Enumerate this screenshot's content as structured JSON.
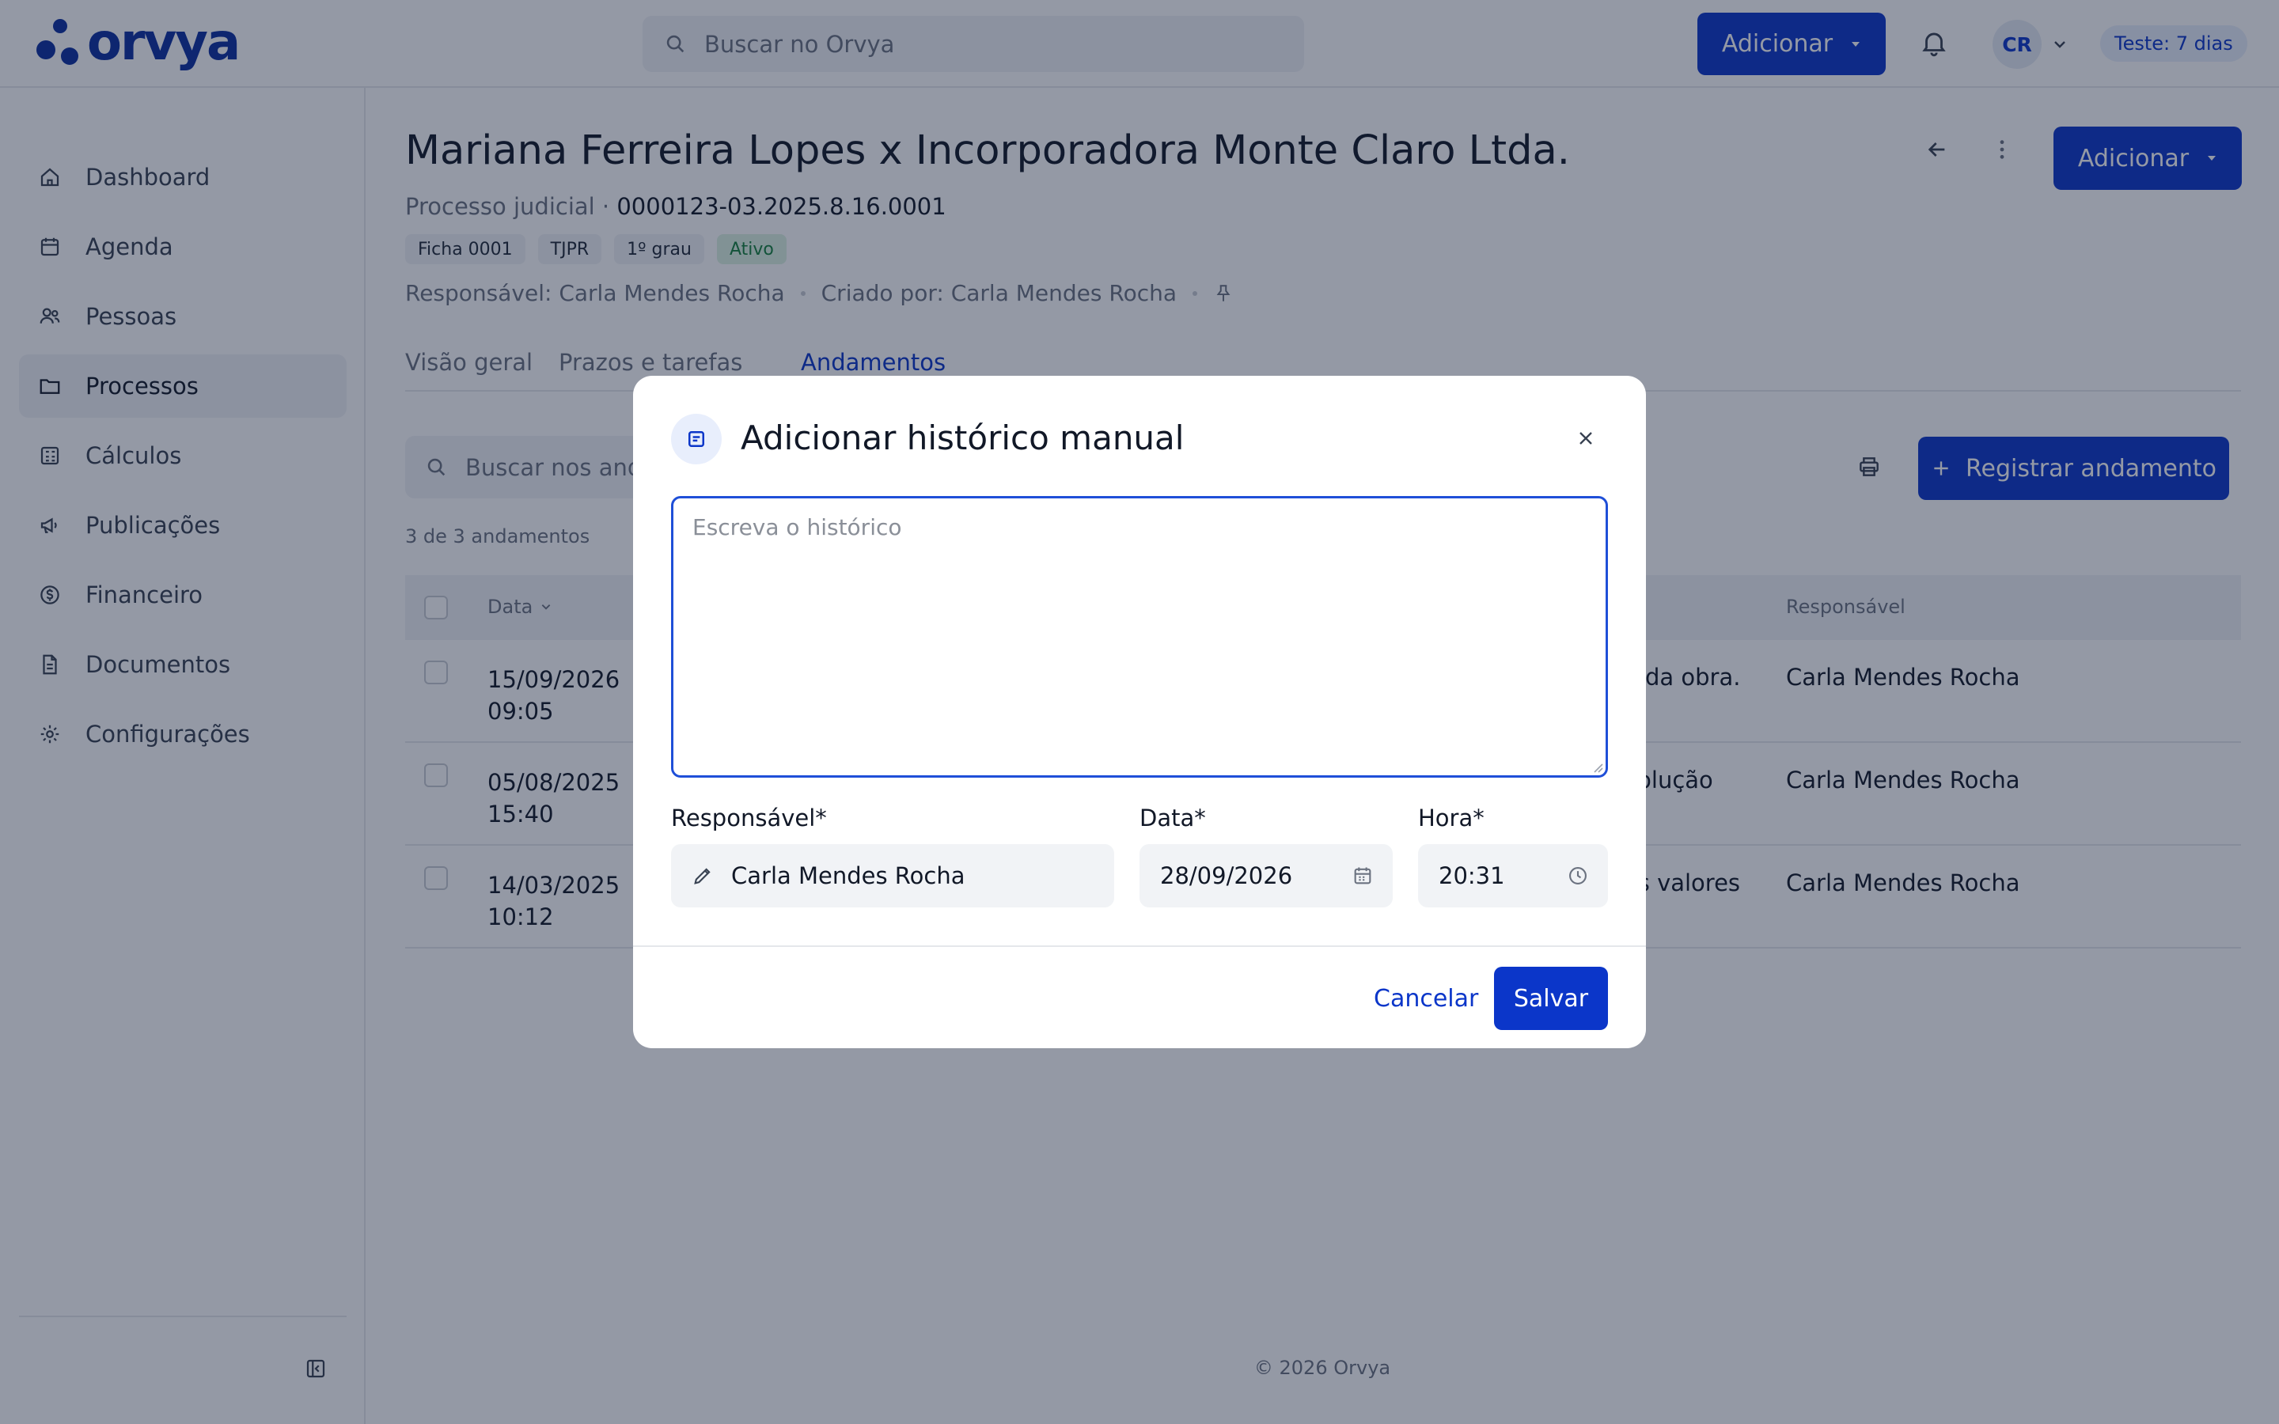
{
  "app": {
    "logo_text": "orvya",
    "brand_color": "#0b36c9"
  },
  "topbar": {
    "search_placeholder": "Buscar no Orvya",
    "add_label": "Adicionar",
    "avatar_initials": "CR",
    "trial_label": "Teste: 7 dias"
  },
  "sidebar": {
    "items": [
      {
        "label": "Dashboard",
        "icon": "home-icon"
      },
      {
        "label": "Agenda",
        "icon": "calendar-icon"
      },
      {
        "label": "Pessoas",
        "icon": "people-icon"
      },
      {
        "label": "Processos",
        "icon": "folder-icon",
        "active": true
      },
      {
        "label": "Cálculos",
        "icon": "calculator-icon"
      },
      {
        "label": "Publicações",
        "icon": "megaphone-icon"
      },
      {
        "label": "Financeiro",
        "icon": "dollar-circle-icon"
      },
      {
        "label": "Documentos",
        "icon": "document-icon"
      },
      {
        "label": "Configurações",
        "icon": "gear-icon"
      }
    ]
  },
  "process": {
    "title": "Mariana Ferreira Lopes x Incorporadora Monte Claro Ltda.",
    "type_label": "Processo judicial · ",
    "number": "0000123-03.2025.8.16.0001",
    "tags": [
      "Ficha 0001",
      "TJPR",
      "1º grau",
      "Ativo"
    ],
    "responsible": "Responsável: Carla Mendes Rocha",
    "created_by": "Criado por: Carla Mendes Rocha",
    "add_label": "Adicionar"
  },
  "tabs": [
    "Visão geral",
    "Prazos e tarefas",
    "Andamentos"
  ],
  "andamentos": {
    "search_placeholder": "Buscar nos andamentos",
    "register_label": "Registrar andamento",
    "count_label": "3 de 3 andamentos",
    "columns": {
      "date": "Data",
      "responsible": "Responsável"
    },
    "rows": [
      {
        "date": "15/09/2026",
        "time": "09:05",
        "desc": "a da obra.",
        "responsible": "Carla Mendes Rocha"
      },
      {
        "date": "05/08/2025",
        "time": "15:40",
        "desc": "volução",
        "responsible": "Carla Mendes Rocha"
      },
      {
        "date": "14/03/2025",
        "time": "10:12",
        "desc": "os valores",
        "responsible": "Carla Mendes Rocha"
      }
    ]
  },
  "footer": "© 2026 Orvya",
  "modal": {
    "title": "Adicionar histórico manual",
    "textarea_placeholder": "Escreva o histórico",
    "responsible_label": "Responsável*",
    "responsible_value": "Carla Mendes Rocha",
    "date_label": "Data*",
    "date_value": "28/09/2026",
    "time_label": "Hora*",
    "time_value": "20:31",
    "cancel_label": "Cancelar",
    "save_label": "Salvar"
  }
}
